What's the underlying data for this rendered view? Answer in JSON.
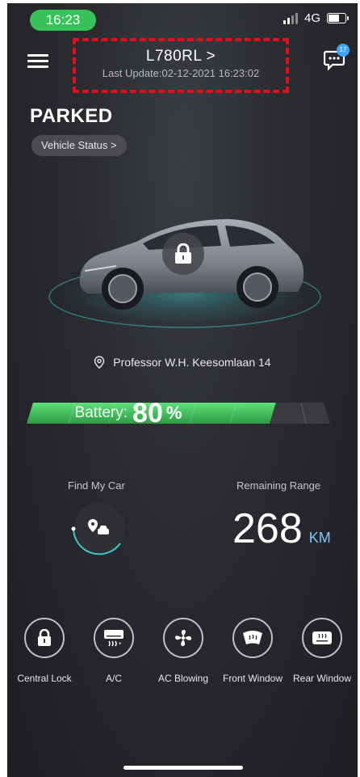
{
  "status_bar": {
    "time": "16:23",
    "network": "4G"
  },
  "header": {
    "plate": "L780RL >",
    "last_update": "Last Update:02-12-2021 16:23:02",
    "messages_badge": "17"
  },
  "vehicle": {
    "state": "PARKED",
    "status_button": "Vehicle Status >",
    "address": "Professor W.H. Keesomlaan 14",
    "locked": true
  },
  "battery": {
    "label": "Battery:",
    "value": "80",
    "unit": "%",
    "level": 0.8
  },
  "find_car": {
    "label": "Find My Car"
  },
  "range": {
    "label": "Remaining Range",
    "value": "268",
    "unit": "KM"
  },
  "controls": [
    {
      "label": "Central Lock",
      "icon": "lock-icon"
    },
    {
      "label": "A/C",
      "icon": "air-conditioner-icon"
    },
    {
      "label": "AC Blowing",
      "icon": "fan-icon"
    },
    {
      "label": "Front Window",
      "icon": "front-defrost-icon"
    },
    {
      "label": "Rear Window",
      "icon": "rear-defrost-icon"
    }
  ],
  "colors": {
    "accent_green": "#4fd36a",
    "status_pill": "#37c25a",
    "highlight_red": "#e0101a",
    "range_unit": "#7fc6ff"
  }
}
